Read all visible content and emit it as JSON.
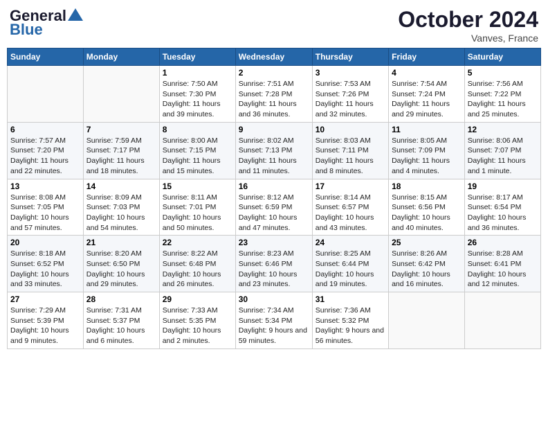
{
  "header": {
    "logo_general": "General",
    "logo_blue": "Blue",
    "month": "October 2024",
    "location": "Vanves, France"
  },
  "weekdays": [
    "Sunday",
    "Monday",
    "Tuesday",
    "Wednesday",
    "Thursday",
    "Friday",
    "Saturday"
  ],
  "weeks": [
    [
      null,
      null,
      {
        "day": "1",
        "sunrise": "Sunrise: 7:50 AM",
        "sunset": "Sunset: 7:30 PM",
        "daylight": "Daylight: 11 hours and 39 minutes."
      },
      {
        "day": "2",
        "sunrise": "Sunrise: 7:51 AM",
        "sunset": "Sunset: 7:28 PM",
        "daylight": "Daylight: 11 hours and 36 minutes."
      },
      {
        "day": "3",
        "sunrise": "Sunrise: 7:53 AM",
        "sunset": "Sunset: 7:26 PM",
        "daylight": "Daylight: 11 hours and 32 minutes."
      },
      {
        "day": "4",
        "sunrise": "Sunrise: 7:54 AM",
        "sunset": "Sunset: 7:24 PM",
        "daylight": "Daylight: 11 hours and 29 minutes."
      },
      {
        "day": "5",
        "sunrise": "Sunrise: 7:56 AM",
        "sunset": "Sunset: 7:22 PM",
        "daylight": "Daylight: 11 hours and 25 minutes."
      }
    ],
    [
      {
        "day": "6",
        "sunrise": "Sunrise: 7:57 AM",
        "sunset": "Sunset: 7:20 PM",
        "daylight": "Daylight: 11 hours and 22 minutes."
      },
      {
        "day": "7",
        "sunrise": "Sunrise: 7:59 AM",
        "sunset": "Sunset: 7:17 PM",
        "daylight": "Daylight: 11 hours and 18 minutes."
      },
      {
        "day": "8",
        "sunrise": "Sunrise: 8:00 AM",
        "sunset": "Sunset: 7:15 PM",
        "daylight": "Daylight: 11 hours and 15 minutes."
      },
      {
        "day": "9",
        "sunrise": "Sunrise: 8:02 AM",
        "sunset": "Sunset: 7:13 PM",
        "daylight": "Daylight: 11 hours and 11 minutes."
      },
      {
        "day": "10",
        "sunrise": "Sunrise: 8:03 AM",
        "sunset": "Sunset: 7:11 PM",
        "daylight": "Daylight: 11 hours and 8 minutes."
      },
      {
        "day": "11",
        "sunrise": "Sunrise: 8:05 AM",
        "sunset": "Sunset: 7:09 PM",
        "daylight": "Daylight: 11 hours and 4 minutes."
      },
      {
        "day": "12",
        "sunrise": "Sunrise: 8:06 AM",
        "sunset": "Sunset: 7:07 PM",
        "daylight": "Daylight: 11 hours and 1 minute."
      }
    ],
    [
      {
        "day": "13",
        "sunrise": "Sunrise: 8:08 AM",
        "sunset": "Sunset: 7:05 PM",
        "daylight": "Daylight: 10 hours and 57 minutes."
      },
      {
        "day": "14",
        "sunrise": "Sunrise: 8:09 AM",
        "sunset": "Sunset: 7:03 PM",
        "daylight": "Daylight: 10 hours and 54 minutes."
      },
      {
        "day": "15",
        "sunrise": "Sunrise: 8:11 AM",
        "sunset": "Sunset: 7:01 PM",
        "daylight": "Daylight: 10 hours and 50 minutes."
      },
      {
        "day": "16",
        "sunrise": "Sunrise: 8:12 AM",
        "sunset": "Sunset: 6:59 PM",
        "daylight": "Daylight: 10 hours and 47 minutes."
      },
      {
        "day": "17",
        "sunrise": "Sunrise: 8:14 AM",
        "sunset": "Sunset: 6:57 PM",
        "daylight": "Daylight: 10 hours and 43 minutes."
      },
      {
        "day": "18",
        "sunrise": "Sunrise: 8:15 AM",
        "sunset": "Sunset: 6:56 PM",
        "daylight": "Daylight: 10 hours and 40 minutes."
      },
      {
        "day": "19",
        "sunrise": "Sunrise: 8:17 AM",
        "sunset": "Sunset: 6:54 PM",
        "daylight": "Daylight: 10 hours and 36 minutes."
      }
    ],
    [
      {
        "day": "20",
        "sunrise": "Sunrise: 8:18 AM",
        "sunset": "Sunset: 6:52 PM",
        "daylight": "Daylight: 10 hours and 33 minutes."
      },
      {
        "day": "21",
        "sunrise": "Sunrise: 8:20 AM",
        "sunset": "Sunset: 6:50 PM",
        "daylight": "Daylight: 10 hours and 29 minutes."
      },
      {
        "day": "22",
        "sunrise": "Sunrise: 8:22 AM",
        "sunset": "Sunset: 6:48 PM",
        "daylight": "Daylight: 10 hours and 26 minutes."
      },
      {
        "day": "23",
        "sunrise": "Sunrise: 8:23 AM",
        "sunset": "Sunset: 6:46 PM",
        "daylight": "Daylight: 10 hours and 23 minutes."
      },
      {
        "day": "24",
        "sunrise": "Sunrise: 8:25 AM",
        "sunset": "Sunset: 6:44 PM",
        "daylight": "Daylight: 10 hours and 19 minutes."
      },
      {
        "day": "25",
        "sunrise": "Sunrise: 8:26 AM",
        "sunset": "Sunset: 6:42 PM",
        "daylight": "Daylight: 10 hours and 16 minutes."
      },
      {
        "day": "26",
        "sunrise": "Sunrise: 8:28 AM",
        "sunset": "Sunset: 6:41 PM",
        "daylight": "Daylight: 10 hours and 12 minutes."
      }
    ],
    [
      {
        "day": "27",
        "sunrise": "Sunrise: 7:29 AM",
        "sunset": "Sunset: 5:39 PM",
        "daylight": "Daylight: 10 hours and 9 minutes."
      },
      {
        "day": "28",
        "sunrise": "Sunrise: 7:31 AM",
        "sunset": "Sunset: 5:37 PM",
        "daylight": "Daylight: 10 hours and 6 minutes."
      },
      {
        "day": "29",
        "sunrise": "Sunrise: 7:33 AM",
        "sunset": "Sunset: 5:35 PM",
        "daylight": "Daylight: 10 hours and 2 minutes."
      },
      {
        "day": "30",
        "sunrise": "Sunrise: 7:34 AM",
        "sunset": "Sunset: 5:34 PM",
        "daylight": "Daylight: 9 hours and 59 minutes."
      },
      {
        "day": "31",
        "sunrise": "Sunrise: 7:36 AM",
        "sunset": "Sunset: 5:32 PM",
        "daylight": "Daylight: 9 hours and 56 minutes."
      },
      null,
      null
    ]
  ]
}
